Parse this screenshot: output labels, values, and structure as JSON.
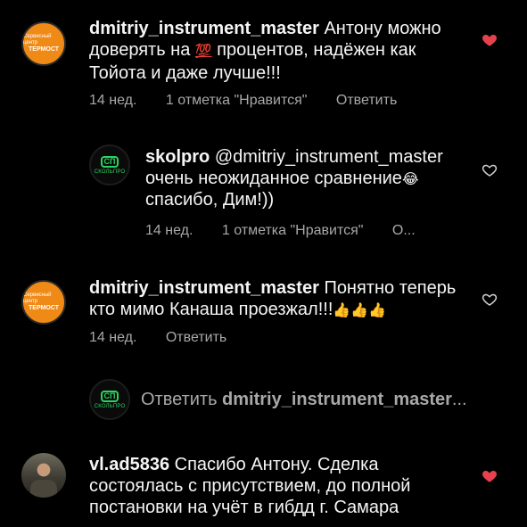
{
  "comments": [
    {
      "user": "dmitriy_instrument_master",
      "text_a": "Антону можно доверять на ",
      "emoji": "💯",
      "text_b": " процентов, надёжен как Тойота и даже лучше!!!",
      "time": "14 нед.",
      "likes": "1 отметка \"Нравится\"",
      "reply": "Ответить",
      "liked": true,
      "avatar_lines": [
        "Сервисный центр",
        "ТЕРМОСТ"
      ]
    },
    {
      "user": "skolpro",
      "text_a": "@dmitriy_instrument_master очень неожиданное сравнение",
      "emoji": "😂",
      "text_b": " спасибо, Дим!))",
      "time": "14 нед.",
      "likes": "1 отметка \"Нравится\"",
      "reply": "О...",
      "liked": false,
      "avatar_logo": "СП",
      "avatar_label": "СКОЛЬПРО"
    },
    {
      "user": "dmitriy_instrument_master",
      "text_a": "Понятно теперь кто мимо Канаша проезжал!!!",
      "emoji": "👍👍👍",
      "text_b": "",
      "time": "14 нед.",
      "reply": "Ответить",
      "liked": false,
      "avatar_lines": [
        "Сервисный центр",
        "ТЕРМОСТ"
      ]
    },
    {
      "user": "vl.ad5836",
      "text_a": "Спасибо Антону. Сделка состоялась с присутствием, до полной постановки на учёт в гибдд г. Самара",
      "text_b": "",
      "liked": true
    }
  ],
  "reply_box": {
    "prefix": "Ответить ",
    "target": "dmitriy_instrument_master",
    "suffix": "...",
    "avatar_logo": "СП",
    "avatar_label": "СКОЛЬПРО"
  },
  "colors": {
    "heart_filled": "#e8414e",
    "heart_outline": "#d0d0d0",
    "brand_green": "#2bd45f",
    "avatar_orange": "#f08a16"
  }
}
